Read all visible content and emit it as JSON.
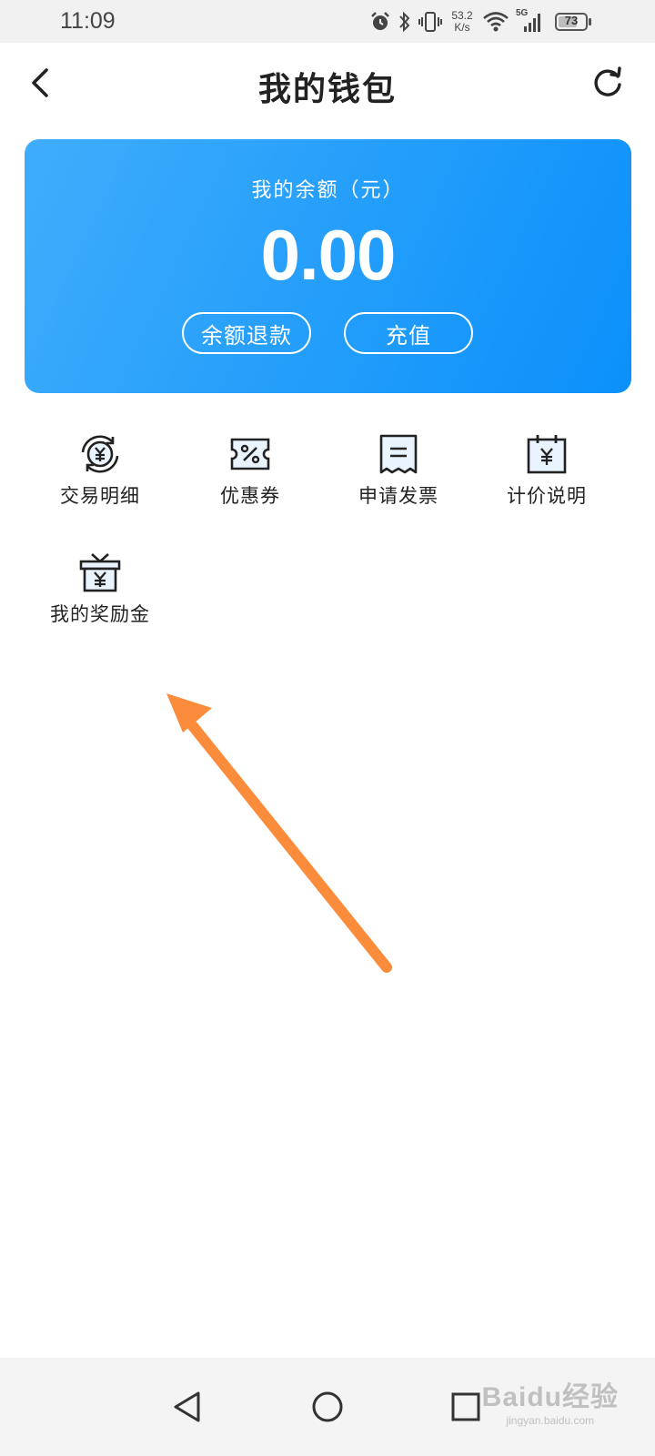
{
  "status_bar": {
    "time": "11:09",
    "net_speed_value": "53.2",
    "net_speed_unit": "K/s",
    "network_type": "5G",
    "battery_level": "73",
    "battery_fraction": 0.73,
    "icons": [
      "alarm-icon",
      "bluetooth-icon",
      "vibrate-icon",
      "wifi-icon",
      "cellular-signal-icon",
      "battery-icon"
    ]
  },
  "header": {
    "title": "我的钱包",
    "back_icon": "chevron-left-icon",
    "refresh_icon": "refresh-icon"
  },
  "balance_card": {
    "label": "我的余额（元）",
    "amount": "0.00",
    "refund_label": "余额退款",
    "recharge_label": "充值",
    "colors": {
      "start": "#3fadfb",
      "end": "#0b90fb"
    }
  },
  "menu": [
    {
      "label": "交易明细",
      "icon": "yen-exchange-icon"
    },
    {
      "label": "优惠券",
      "icon": "coupon-icon"
    },
    {
      "label": "申请发票",
      "icon": "invoice-icon"
    },
    {
      "label": "计价说明",
      "icon": "pricing-calendar-icon"
    },
    {
      "label": "我的奖励金",
      "icon": "reward-gift-icon"
    }
  ],
  "annotation": {
    "color": "#fb8c3c",
    "icon": "arrow-annotation"
  },
  "nav_bar": {
    "icons": [
      "back-triangle-icon",
      "home-circle-icon",
      "recents-square-icon"
    ]
  },
  "watermark": {
    "main": "Baidu经验",
    "sub": "jingyan.baidu.com"
  }
}
